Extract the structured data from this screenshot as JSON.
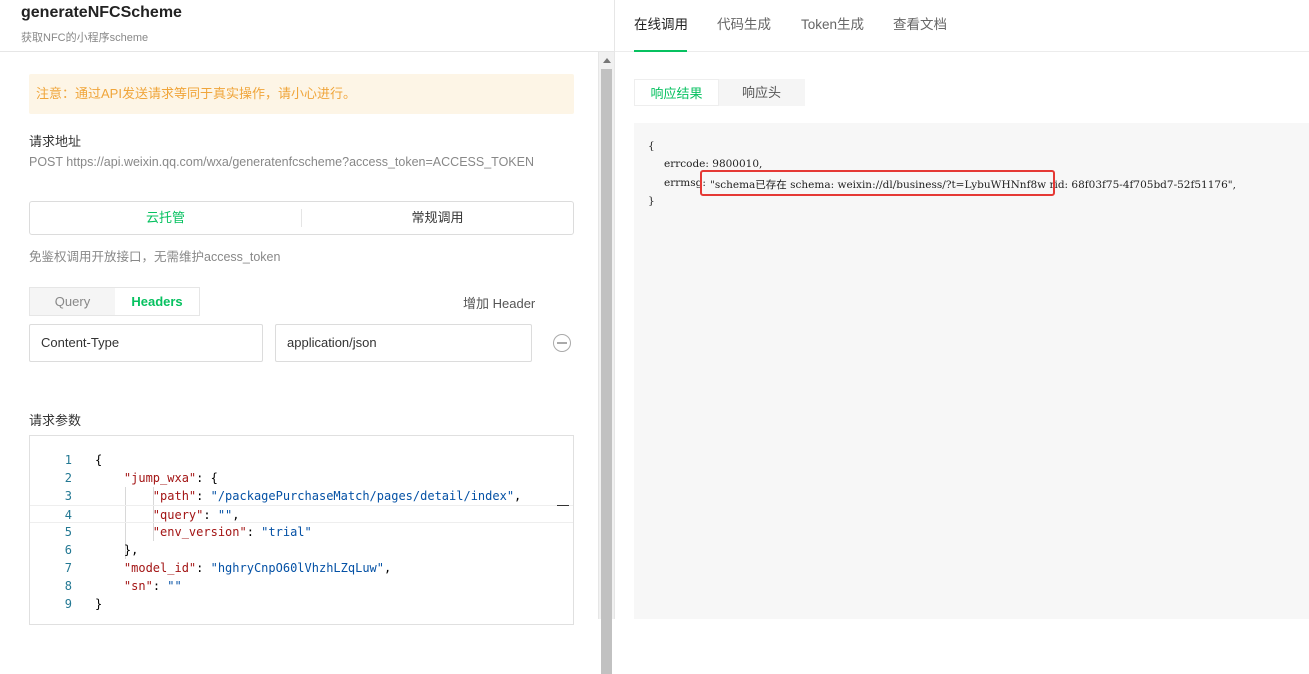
{
  "header": {
    "title": "generateNFCScheme",
    "subtitle": "获取NFC的小程序scheme"
  },
  "notice": "注意：通过API发送请求等同于真实操作，请小心进行。",
  "request_url": {
    "label": "请求地址",
    "value": "POST https://api.weixin.qq.com/wxa/generatenfcscheme?access_token=ACCESS_TOKEN"
  },
  "call_mode": {
    "options": [
      "云托管",
      "常规调用"
    ],
    "selected": "云托管",
    "hint": "免鉴权调用开放接口，无需维护access_token"
  },
  "param_tabs": {
    "items": [
      "Query",
      "Headers"
    ],
    "selected": "Headers",
    "add_header": "增加 Header"
  },
  "header_row": {
    "key": "Content-Type",
    "value": "application/json"
  },
  "body": {
    "label": "请求参数",
    "line_numbers": [
      "1",
      "2",
      "3",
      "4",
      "5",
      "6",
      "7",
      "8",
      "9"
    ],
    "lines": [
      "{",
      "    \"jump_wxa\": {",
      "        \"path\": \"/packagePurchaseMatch/pages/detail/index\",",
      "        \"query\": \"\",",
      "        \"env_version\": \"trial\"",
      "    },",
      "    \"model_id\": \"hghryCnpO60lVhzhLZqLuw\",",
      "    \"sn\": \"\"",
      "}"
    ]
  },
  "right_tabs": {
    "items": [
      "在线调用",
      "代码生成",
      "Token生成",
      "查看文档"
    ],
    "selected": "在线调用"
  },
  "result_tabs": {
    "items": [
      "响应结果",
      "响应头"
    ],
    "selected": "响应结果"
  },
  "response": {
    "open": "{",
    "errcode_line": "errcode: 9800010,",
    "errmsg_key": "errmsg:",
    "errmsg_value": "\"schema已存在 schema: weixin://dl/business/?t=LybuWHNnf8w rid: 68f03f75-4f705bd7-52f51176\",",
    "close": "}"
  },
  "colors": {
    "accent": "#07c160",
    "warning": "#f0a53a",
    "highlight_border": "#e53935"
  }
}
